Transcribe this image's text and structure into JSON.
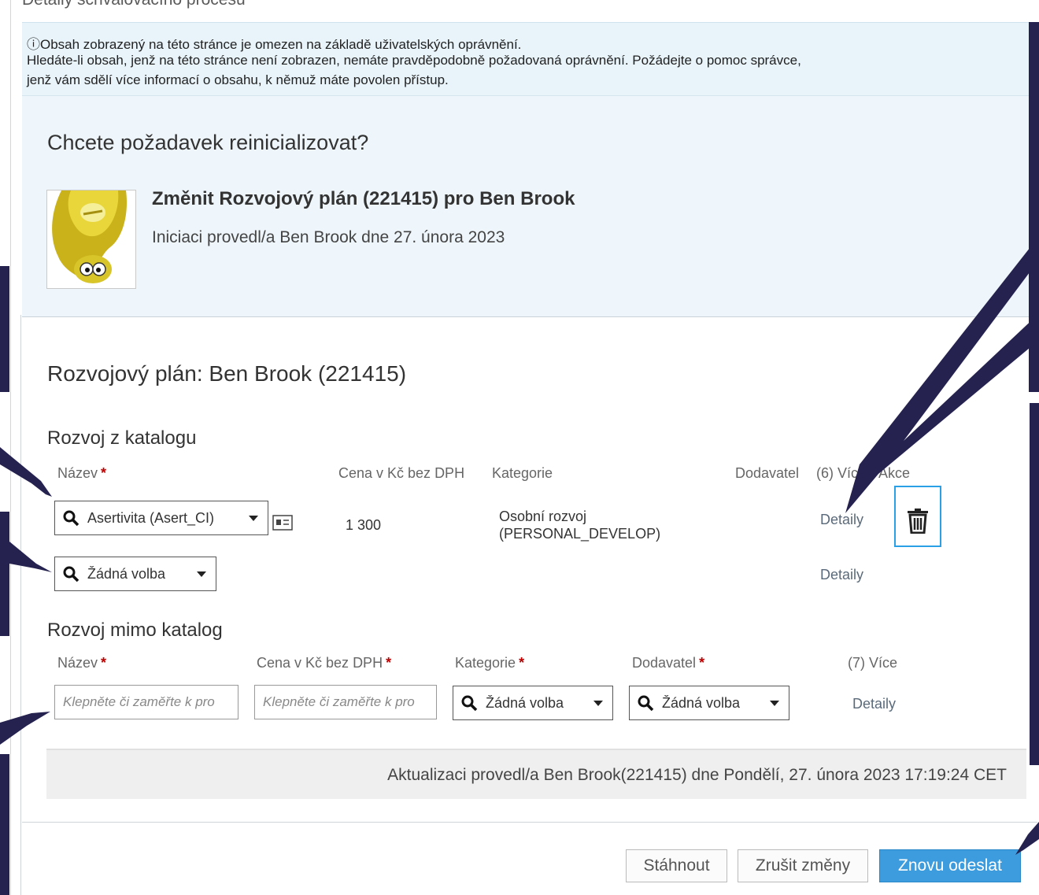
{
  "page": {
    "top_title": "Detaily schvalovacího procesu"
  },
  "info_banner": {
    "line1": "ⓘObsah zobrazený na této stránce je omezen na základě uživatelských oprávnění.",
    "line2": "Hledáte-li obsah, jenž na této stránce není zobrazen, nemáte pravděpodobně požadovaná oprávnění. Požádejte o pomoc správce,",
    "line3": "jenž vám sdělí více informací o obsahu, k němuž máte povolen přístup."
  },
  "request": {
    "question": "Chcete požadavek reinicializovat?",
    "title": "Změnit Rozvojový plán (221415) pro Ben Brook",
    "subtitle": "Iniciaci provedl/a Ben Brook dne 27. února 2023"
  },
  "plan": {
    "title": "Rozvojový plán: Ben Brook (221415)",
    "catalog": {
      "section_title": "Rozvoj z katalogu",
      "headers": {
        "name": "Název",
        "price": "Cena v Kč bez DPH",
        "category": "Kategorie",
        "supplier": "Dodavatel",
        "more": "(6) Více",
        "actions": "Akce"
      },
      "rows": [
        {
          "name": "Asertivita (Asert_CI)",
          "price": "1 300",
          "category_line1": "Osobní rozvoj",
          "category_line2": "(PERSONAL_DEVELOP)",
          "details": "Detaily"
        },
        {
          "name": "Žádná volba",
          "details": "Detaily"
        }
      ]
    },
    "outside": {
      "section_title": "Rozvoj mimo katalog",
      "headers": {
        "name": "Název",
        "price": "Cena v Kč bez DPH",
        "category": "Kategorie",
        "supplier": "Dodavatel",
        "more": "(7) Více"
      },
      "name_placeholder": "Klepněte či zaměřte k pro",
      "price_placeholder": "Klepněte či zaměřte k pro",
      "category_value": "Žádná volba",
      "supplier_value": "Žádná volba",
      "details": "Detaily"
    }
  },
  "update_info": "Aktualizaci provedl/a Ben Brook(221415) dne Pondělí, 27. února 2023 17:19:24 CET",
  "buttons": {
    "download": "Stáhnout",
    "cancel": "Zrušit změny",
    "resubmit": "Znovu odeslat"
  },
  "colors": {
    "accent": "#3d9cdd",
    "info_bg": "#e8f4fa",
    "annotation": "#25224f",
    "focus_border": "#2aa0e6"
  }
}
